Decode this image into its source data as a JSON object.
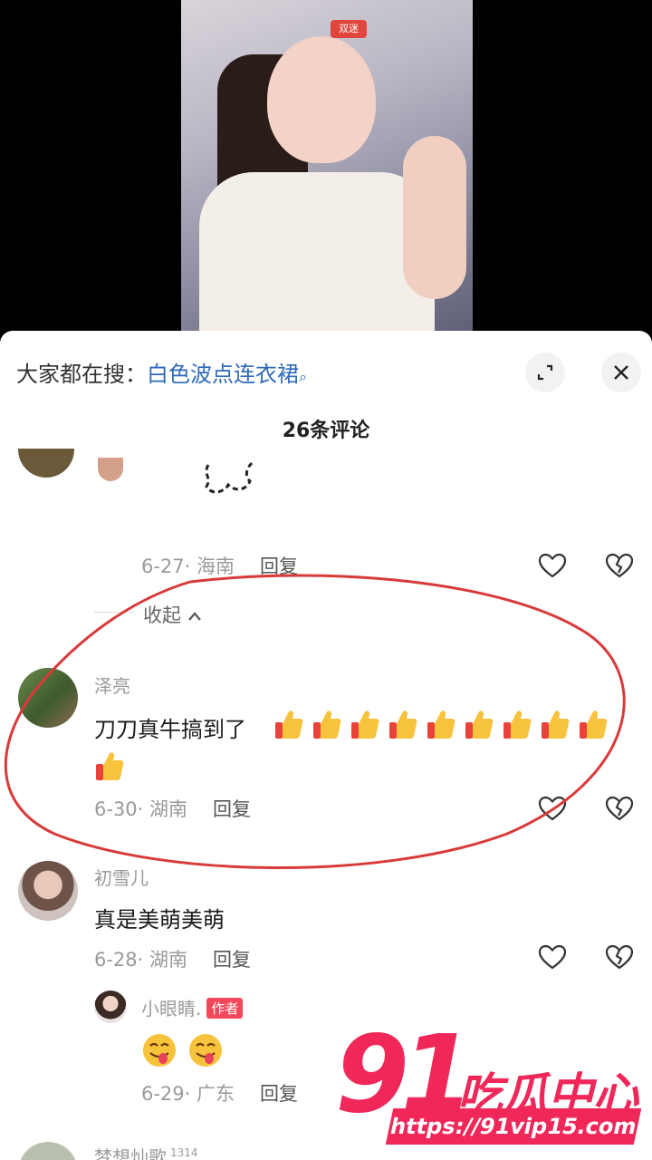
{
  "video": {
    "badge": "双迷"
  },
  "search": {
    "prefix": "大家都在搜：",
    "term": "白色波点连衣裙"
  },
  "sheet": {
    "title": "26条评论"
  },
  "partial_comment": {
    "date": "6-27",
    "location": "· 海南",
    "reply_label": "回复"
  },
  "collapse_label": "收起",
  "comments": [
    {
      "username": "泽亮",
      "text": "刀刀真牛搞到了",
      "date": "6-30",
      "location": "· 湖南",
      "reply_label": "回复",
      "thumbs_count": 10
    },
    {
      "username": "初雪儿",
      "text": "真是美萌美萌",
      "date": "6-28",
      "location": "· 湖南",
      "reply_label": "回复"
    }
  ],
  "reply": {
    "username": "小眼睛.",
    "author_tag": "作者",
    "date": "6-29",
    "location": "· 广东",
    "reply_label": "回复"
  },
  "next_comment": {
    "username": "梦想灿歌",
    "badge": "1314"
  },
  "watermark": {
    "number": "91",
    "text": "吃瓜中心",
    "url": "https://91vip15.com"
  },
  "colors": {
    "accent": "#2e6bb8",
    "author_tag": "#f2485a",
    "watermark": "#f0285a",
    "annotation": "#d93a3a"
  }
}
